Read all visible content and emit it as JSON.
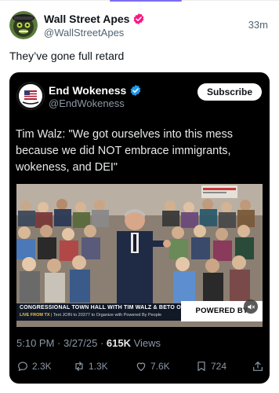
{
  "outer_post": {
    "display_name": "Wall Street Apes",
    "handle": "@WallStreetApes",
    "time_ago": "33m",
    "text": "They’ve gone full retard"
  },
  "quoted_post": {
    "display_name": "End Wokeness",
    "handle": "@EndWokeness",
    "subscribe_label": "Subscribe",
    "text": "Tim Walz: \"We got ourselves into this mess because we did NOT embrace immigrants, wokeness, and DEI\"",
    "video": {
      "lower_third_headline": "CONGRESSIONAL TOWN HALL WITH TIM WALZ & BETO O'ROURKE",
      "lower_third_live": "LIVE FROM TX",
      "lower_third_ticker": "Text JOIN to 20377 to Organize with Powered By People",
      "powered_by_label": "POWERED BY PEOPLE"
    },
    "timestamp": "5:10 PM · 3/27/25 · ",
    "views_count": "615K",
    "views_label": " Views",
    "actions": {
      "replies": "2.3K",
      "reposts": "1.3K",
      "likes": "7.6K",
      "bookmarks": "724"
    }
  },
  "colors": {
    "verified_badge": "#f91880",
    "verified_badge_blue": "#1d9bf0",
    "quote_card_bg": "#000000",
    "accent_line": "#7b6cf0"
  },
  "icons": {
    "outer_verified": "verified-badge-pink-icon",
    "quoted_verified": "verified-badge-blue-icon",
    "reply": "reply-bubble-icon",
    "repost": "repost-arrows-icon",
    "like": "heart-icon",
    "bookmark": "bookmark-icon",
    "share": "share-upload-icon",
    "volume": "speaker-icon"
  }
}
